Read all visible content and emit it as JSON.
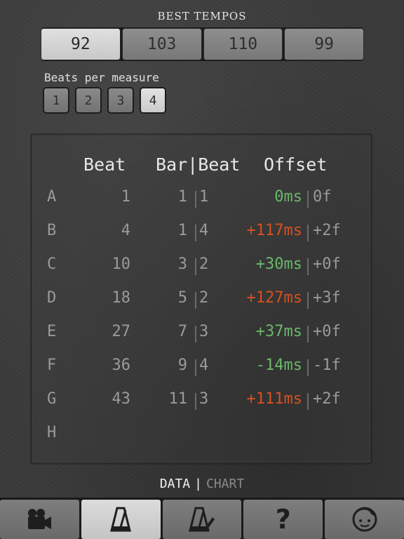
{
  "header": {
    "title": "BEST TEMPOS"
  },
  "tempos": [
    "92",
    "103",
    "110",
    "99"
  ],
  "selected_tempo_index": 0,
  "beats_per_measure": {
    "label": "Beats per measure",
    "options": [
      "1",
      "2",
      "3",
      "4"
    ],
    "selected": "4"
  },
  "table": {
    "headers": {
      "beat": "Beat",
      "bar_beat": "Bar|Beat",
      "offset": "Offset"
    },
    "rows": [
      {
        "letter": "A",
        "beat": "1",
        "bar": "1",
        "bbeat": "1",
        "ms": "0ms",
        "frames": "0f",
        "status": "good"
      },
      {
        "letter": "B",
        "beat": "4",
        "bar": "1",
        "bbeat": "4",
        "ms": "+117ms",
        "frames": "+2f",
        "status": "bad"
      },
      {
        "letter": "C",
        "beat": "10",
        "bar": "3",
        "bbeat": "2",
        "ms": "+30ms",
        "frames": "+0f",
        "status": "good"
      },
      {
        "letter": "D",
        "beat": "18",
        "bar": "5",
        "bbeat": "2",
        "ms": "+127ms",
        "frames": "+3f",
        "status": "bad"
      },
      {
        "letter": "E",
        "beat": "27",
        "bar": "7",
        "bbeat": "3",
        "ms": "+37ms",
        "frames": "+0f",
        "status": "good"
      },
      {
        "letter": "F",
        "beat": "36",
        "bar": "9",
        "bbeat": "4",
        "ms": "-14ms",
        "frames": "-1f",
        "status": "good"
      },
      {
        "letter": "G",
        "beat": "43",
        "bar": "11",
        "bbeat": "3",
        "ms": "+111ms",
        "frames": "+2f",
        "status": "bad"
      },
      {
        "letter": "H",
        "beat": "",
        "bar": "",
        "bbeat": "",
        "ms": "",
        "frames": "",
        "status": "empty"
      }
    ]
  },
  "view_switch": {
    "data": "DATA",
    "separator": "|",
    "chart": "CHART",
    "active": "DATA"
  },
  "colors": {
    "good": "#6ab86a",
    "bad": "#d8501f"
  },
  "tabbar": {
    "items": [
      {
        "icon": "video-camera-icon",
        "active": false
      },
      {
        "icon": "metronome-icon",
        "active": true
      },
      {
        "icon": "metronome-edit-icon",
        "active": false
      },
      {
        "icon": "question-mark-icon",
        "active": false
      },
      {
        "icon": "face-icon",
        "active": false
      }
    ],
    "question_glyph": "?"
  }
}
